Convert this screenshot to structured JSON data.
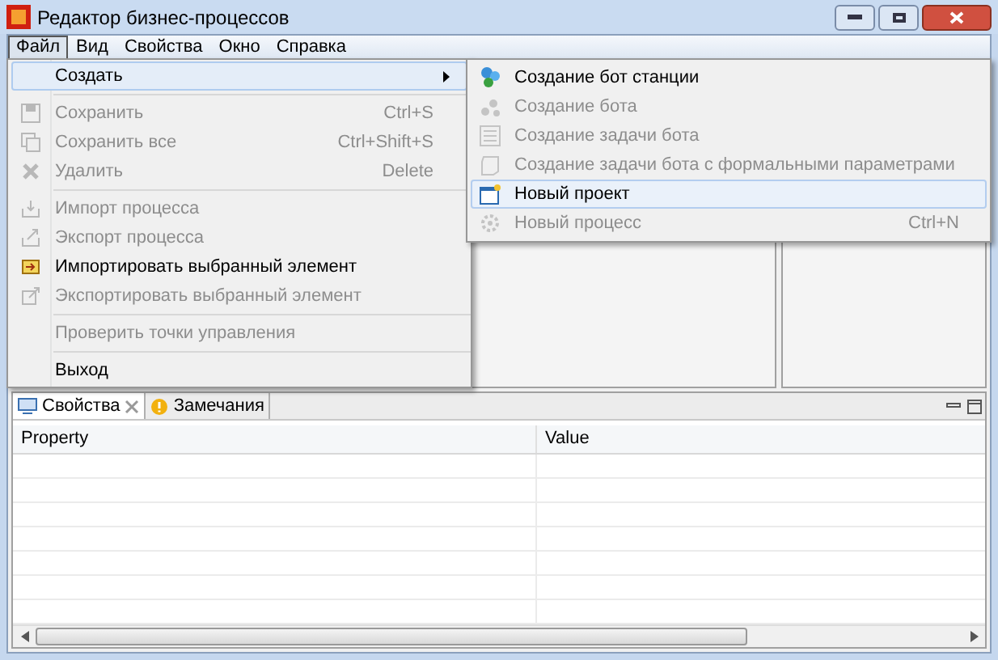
{
  "window": {
    "title": "Редактор бизнес-процессов"
  },
  "menubar": [
    {
      "label": "Файл",
      "selected": true
    },
    {
      "label": "Вид",
      "selected": false
    },
    {
      "label": "Свойства",
      "selected": false
    },
    {
      "label": "Окно",
      "selected": false
    },
    {
      "label": "Справка",
      "selected": false
    }
  ],
  "file_menu": [
    {
      "kind": "item",
      "label": "Создать",
      "disabled": false,
      "selected": true,
      "submenu": true
    },
    {
      "kind": "separator"
    },
    {
      "kind": "item",
      "label": "Сохранить",
      "shortcut": "Ctrl+S",
      "disabled": true,
      "selected": false,
      "submenu": false
    },
    {
      "kind": "item",
      "label": "Сохранить все",
      "shortcut": "Ctrl+Shift+S",
      "disabled": true,
      "selected": false,
      "submenu": false
    },
    {
      "kind": "item",
      "label": "Удалить",
      "shortcut": "Delete",
      "disabled": true,
      "selected": false,
      "submenu": false
    },
    {
      "kind": "separator"
    },
    {
      "kind": "item",
      "label": "Импорт процесса",
      "disabled": true,
      "selected": false,
      "submenu": false
    },
    {
      "kind": "item",
      "label": "Экспорт процесса",
      "disabled": true,
      "selected": false,
      "submenu": false
    },
    {
      "kind": "item",
      "label": "Импортировать выбранный элемент",
      "disabled": false,
      "selected": false,
      "submenu": false
    },
    {
      "kind": "item",
      "label": "Экспортировать выбранный элемент",
      "disabled": true,
      "selected": false,
      "submenu": false
    },
    {
      "kind": "separator"
    },
    {
      "kind": "item",
      "label": "Проверить точки управления",
      "disabled": true,
      "selected": false,
      "submenu": false
    },
    {
      "kind": "separator"
    },
    {
      "kind": "item",
      "label": "Выход",
      "disabled": false,
      "selected": false,
      "submenu": false
    }
  ],
  "create_submenu": [
    {
      "label": "Создание бот станции",
      "disabled": false,
      "selected": false
    },
    {
      "label": "Создание бота",
      "disabled": true,
      "selected": false
    },
    {
      "label": "Создание задачи бота",
      "disabled": true,
      "selected": false
    },
    {
      "label": "Создание задачи бота с формальными параметрами",
      "disabled": true,
      "selected": false
    },
    {
      "label": "Новый проект",
      "disabled": false,
      "selected": true
    },
    {
      "label": "Новый процесс",
      "shortcut": "Ctrl+N",
      "disabled": true,
      "selected": false
    }
  ],
  "bottom_panel": {
    "tabs": [
      {
        "label": "Свойства",
        "selected": true
      },
      {
        "label": "Замечания",
        "selected": false
      }
    ],
    "table": {
      "columns": [
        "Property",
        "Value"
      ]
    }
  }
}
